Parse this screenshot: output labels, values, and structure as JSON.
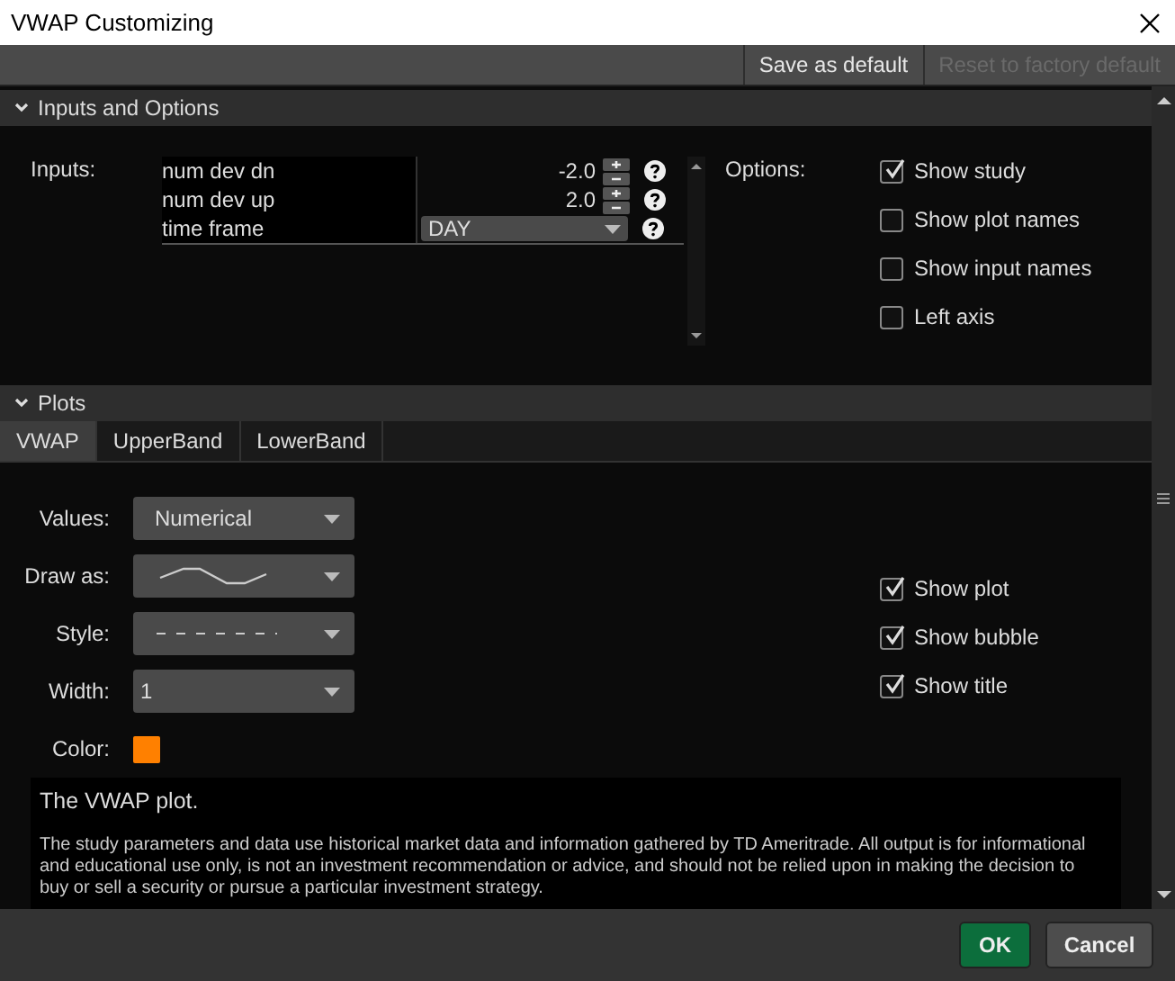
{
  "window": {
    "title": "VWAP Customizing"
  },
  "toolbar": [
    {
      "label": "Save as default",
      "disabled": false
    },
    {
      "label": "Reset to factory default",
      "disabled": true
    }
  ],
  "inputs_section": {
    "title": "Inputs and Options",
    "expanded": true,
    "inputs_label": "Inputs:",
    "inputs": [
      {
        "kind": "number",
        "name": "num dev dn",
        "value": "-2.0"
      },
      {
        "kind": "number",
        "name": "num dev up",
        "value": "2.0"
      },
      {
        "kind": "dropdown",
        "name": "time frame",
        "value": "DAY"
      }
    ],
    "options_label": "Options:",
    "options": [
      {
        "label": "Show study",
        "checked": true
      },
      {
        "label": "Show plot names",
        "checked": false
      },
      {
        "label": "Show input names",
        "checked": false
      },
      {
        "label": "Left axis",
        "checked": false
      }
    ]
  },
  "plots_section": {
    "title": "Plots",
    "expanded": true,
    "tabs": [
      {
        "label": "VWAP",
        "selected": true
      },
      {
        "label": "UpperBand",
        "selected": false
      },
      {
        "label": "LowerBand",
        "selected": false
      }
    ],
    "properties": [
      {
        "kind": "dropdown",
        "label": "Values:",
        "value": "Numerical"
      },
      {
        "kind": "line-preview",
        "label": "Draw as:"
      },
      {
        "kind": "dash-preview",
        "label": "Style:"
      },
      {
        "kind": "dropdown",
        "label": "Width:",
        "value": "1"
      },
      {
        "kind": "color",
        "label": "Color:",
        "color": "#ff8000"
      }
    ],
    "checks": [
      {
        "label": "Show plot",
        "checked": true
      },
      {
        "label": "Show bubble",
        "checked": true
      },
      {
        "label": "Show title",
        "checked": true
      }
    ]
  },
  "description": {
    "title": "The VWAP plot.",
    "disclaimer": "The study parameters and data use historical market data and information gathered by TD Ameritrade. All output is for informational and educational use only, is not an investment recommendation or advice, and should not be relied upon in making the decision to buy or sell a security or pursue a particular investment strategy."
  },
  "buttons": [
    {
      "kind": "primary",
      "label": "OK"
    },
    {
      "kind": "secondary",
      "label": "Cancel"
    }
  ]
}
